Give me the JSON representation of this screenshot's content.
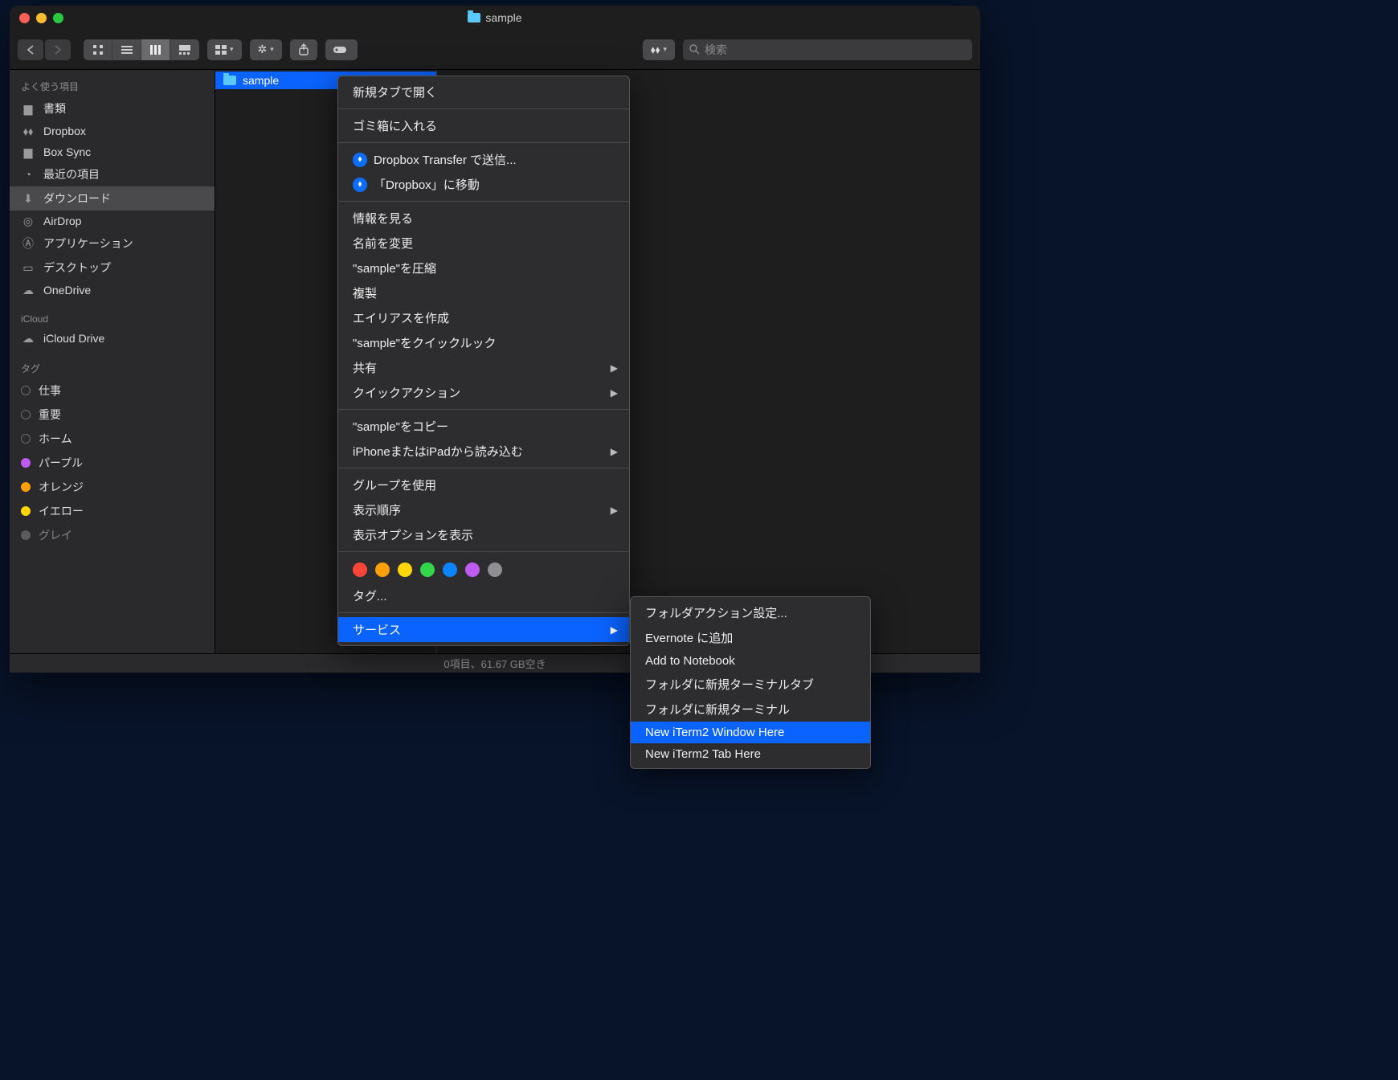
{
  "window": {
    "title": "sample"
  },
  "search": {
    "placeholder": "検索"
  },
  "sidebar": {
    "favorites_header": "よく使う項目",
    "items": [
      {
        "label": "書類"
      },
      {
        "label": "Dropbox"
      },
      {
        "label": "Box Sync"
      },
      {
        "label": "最近の項目"
      },
      {
        "label": "ダウンロード",
        "selected": true
      },
      {
        "label": "AirDrop"
      },
      {
        "label": "アプリケーション"
      },
      {
        "label": "デスクトップ"
      },
      {
        "label": "OneDrive"
      }
    ],
    "icloud_header": "iCloud",
    "icloud_items": [
      {
        "label": "iCloud Drive"
      }
    ],
    "tags_header": "タグ",
    "tags": [
      {
        "label": "仕事",
        "color": ""
      },
      {
        "label": "重要",
        "color": ""
      },
      {
        "label": "ホーム",
        "color": ""
      },
      {
        "label": "パープル",
        "color": "#bf5af2"
      },
      {
        "label": "オレンジ",
        "color": "#ff9f0a"
      },
      {
        "label": "イエロー",
        "color": "#ffd60a"
      },
      {
        "label": "グレイ",
        "color": "#8e8e93"
      }
    ]
  },
  "column": {
    "items": [
      {
        "label": "sample",
        "selected": true
      }
    ]
  },
  "status": {
    "text": "0項目、61.67 GB空き"
  },
  "context_menu": {
    "groups": [
      [
        {
          "label": "新規タブで開く"
        }
      ],
      [
        {
          "label": "ゴミ箱に入れる"
        }
      ],
      [
        {
          "label": "Dropbox Transfer で送信...",
          "icon": "dropbox"
        },
        {
          "label": "「Dropbox」に移動",
          "icon": "dropbox"
        }
      ],
      [
        {
          "label": "情報を見る"
        },
        {
          "label": "名前を変更"
        },
        {
          "label": "\"sample\"を圧縮"
        },
        {
          "label": "複製"
        },
        {
          "label": "エイリアスを作成"
        },
        {
          "label": "\"sample\"をクイックルック"
        },
        {
          "label": "共有",
          "submenu": true
        },
        {
          "label": "クイックアクション",
          "submenu": true
        }
      ],
      [
        {
          "label": "\"sample\"をコピー"
        },
        {
          "label": "iPhoneまたはiPadから読み込む",
          "submenu": true
        }
      ],
      [
        {
          "label": "グループを使用"
        },
        {
          "label": "表示順序",
          "submenu": true
        },
        {
          "label": "表示オプションを表示"
        }
      ]
    ],
    "tag_colors": [
      "#ff453a",
      "#ff9f0a",
      "#ffd60a",
      "#32d74b",
      "#0a84ff",
      "#bf5af2",
      "#8e8e93"
    ],
    "tag_label": "タグ...",
    "services_label": "サービス"
  },
  "services_menu": {
    "items": [
      {
        "label": "フォルダアクション設定..."
      },
      {
        "label": "Evernote に追加"
      },
      {
        "label": "Add to Notebook"
      },
      {
        "label": "フォルダに新規ターミナルタブ"
      },
      {
        "label": "フォルダに新規ターミナル"
      },
      {
        "label": "New iTerm2 Window Here",
        "highlight": true
      },
      {
        "label": "New iTerm2 Tab Here"
      }
    ]
  }
}
